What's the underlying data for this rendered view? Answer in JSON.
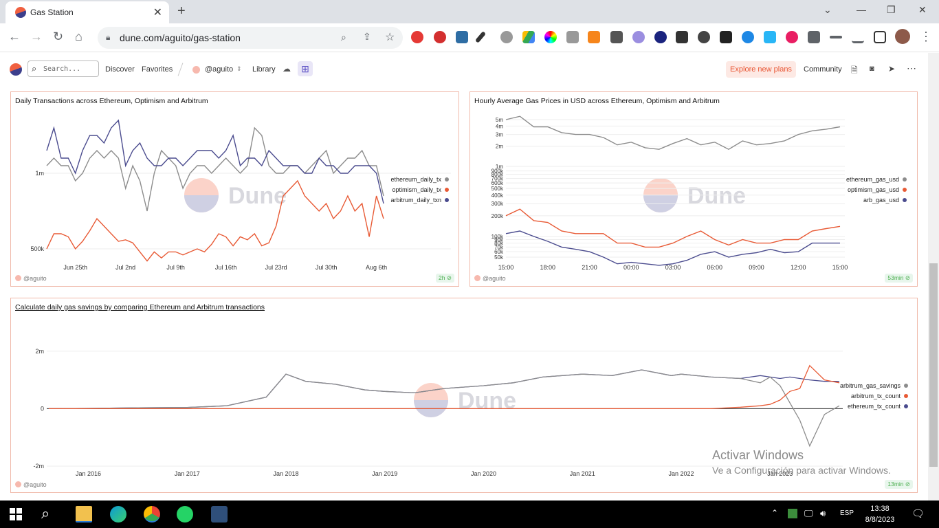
{
  "browser": {
    "tab_title": "Gas Station",
    "url": "dune.com/aguito/gas-station"
  },
  "header": {
    "search_placeholder": "Search...",
    "discover": "Discover",
    "favorites": "Favorites",
    "user": "@aguito",
    "library": "Library",
    "explore": "Explore new plans",
    "community": "Community"
  },
  "cards": [
    {
      "title": "Daily Transactions across Ethereum, Optimism and Arbitrum",
      "owner": "@aguito",
      "badge": "2h"
    },
    {
      "title": "Hourly Average Gas Prices in USD across Ethereum, Optimism and Arbitrum",
      "owner": "@aguito",
      "badge": "53min"
    },
    {
      "title": "Calculate daily gas savings by comparing Ethereum and Arbitrum transactions",
      "owner": "@aguito",
      "badge": "13min"
    }
  ],
  "watermark": "Dune",
  "colors": {
    "ethereum": "#8c8c8c",
    "optimism": "#e85a35",
    "arbitrum": "#4a4b8e"
  },
  "chart_data": [
    {
      "type": "line",
      "title": "Daily Transactions across Ethereum, Optimism and Arbitrum",
      "x": [
        "Jun 21",
        "Jun 22",
        "Jun 23",
        "Jun 24",
        "Jun 25",
        "Jun 26",
        "Jun 27",
        "Jun 28",
        "Jun 29",
        "Jun 30",
        "Jul 1",
        "Jul 2",
        "Jul 3",
        "Jul 4",
        "Jul 5",
        "Jul 6",
        "Jul 7",
        "Jul 8",
        "Jul 9",
        "Jul 10",
        "Jul 11",
        "Jul 12",
        "Jul 13",
        "Jul 14",
        "Jul 15",
        "Jul 16",
        "Jul 17",
        "Jul 18",
        "Jul 19",
        "Jul 20",
        "Jul 21",
        "Jul 22",
        "Jul 23",
        "Jul 24",
        "Jul 25",
        "Jul 26",
        "Jul 27",
        "Jul 28",
        "Jul 29",
        "Jul 30",
        "Jul 31",
        "Aug 1",
        "Aug 2",
        "Aug 3",
        "Aug 4",
        "Aug 5",
        "Aug 6",
        "Aug 7"
      ],
      "x_ticks": [
        "Jun 25th",
        "Jul 2nd",
        "Jul 9th",
        "Jul 16th",
        "Jul 23rd",
        "Jul 30th",
        "Aug 6th"
      ],
      "y_ticks": [
        "1m",
        "500k"
      ],
      "ylim": [
        400000,
        1400000
      ],
      "series": [
        {
          "name": "ethereum_daily_tx",
          "values": [
            1050000,
            1100000,
            1050000,
            1050000,
            950000,
            1000000,
            1100000,
            1150000,
            1100000,
            1150000,
            1100000,
            900000,
            1050000,
            950000,
            750000,
            1000000,
            1150000,
            1100000,
            1050000,
            900000,
            1000000,
            1050000,
            1050000,
            1000000,
            1050000,
            1100000,
            1050000,
            1000000,
            1050000,
            1300000,
            1250000,
            1050000,
            1000000,
            1000000,
            1050000,
            1050000,
            1000000,
            1050000,
            1100000,
            1150000,
            1000000,
            1050000,
            1100000,
            1100000,
            1150000,
            1050000,
            1050000,
            850000
          ]
        },
        {
          "name": "optimism_daily_tx",
          "values": [
            500000,
            600000,
            600000,
            580000,
            500000,
            550000,
            620000,
            700000,
            650000,
            600000,
            550000,
            560000,
            540000,
            480000,
            420000,
            480000,
            440000,
            480000,
            480000,
            460000,
            480000,
            500000,
            480000,
            530000,
            600000,
            580000,
            520000,
            580000,
            560000,
            600000,
            520000,
            540000,
            650000,
            850000,
            900000,
            950000,
            850000,
            800000,
            750000,
            800000,
            700000,
            750000,
            850000,
            750000,
            800000,
            580000,
            850000,
            700000
          ]
        },
        {
          "name": "arbitrum_daily_txn",
          "values": [
            1150000,
            1300000,
            1100000,
            1100000,
            1000000,
            1150000,
            1250000,
            1250000,
            1200000,
            1300000,
            1350000,
            1050000,
            1150000,
            1200000,
            1100000,
            1050000,
            1050000,
            1100000,
            1100000,
            1050000,
            1100000,
            1150000,
            1150000,
            1150000,
            1100000,
            1150000,
            1250000,
            1050000,
            1100000,
            1100000,
            1050000,
            1150000,
            1100000,
            1050000,
            1050000,
            1050000,
            1000000,
            1000000,
            1100000,
            1050000,
            1050000,
            1000000,
            1000000,
            1050000,
            1050000,
            1050000,
            1000000,
            800000
          ]
        }
      ]
    },
    {
      "type": "line",
      "title": "Hourly Average Gas Prices in USD across Ethereum, Optimism and Arbitrum",
      "x": [
        "15:00",
        "16:00",
        "17:00",
        "18:00",
        "19:00",
        "20:00",
        "21:00",
        "22:00",
        "23:00",
        "00:00",
        "01:00",
        "02:00",
        "03:00",
        "04:00",
        "05:00",
        "06:00",
        "07:00",
        "08:00",
        "09:00",
        "10:00",
        "11:00",
        "12:00",
        "13:00",
        "14:00",
        "15:00"
      ],
      "x_ticks": [
        "15:00",
        "18:00",
        "21:00",
        "00:00",
        "03:00",
        "06:00",
        "09:00",
        "12:00",
        "15:00"
      ],
      "y_ticks": [
        "5m",
        "4m",
        "3m",
        "2m",
        "1m",
        "900k",
        "800k",
        "700k",
        "600k",
        "500k",
        "400k",
        "300k",
        "200k",
        "100k",
        "90k",
        "80k",
        "70k",
        "60k",
        "50k"
      ],
      "scale": "log",
      "series": [
        {
          "name": "ethereum_gas_usd",
          "values": [
            5000000,
            5600000,
            3900000,
            3900000,
            3200000,
            3000000,
            3000000,
            2700000,
            2100000,
            2300000,
            1900000,
            1800000,
            2200000,
            2600000,
            2100000,
            2300000,
            1800000,
            2400000,
            2100000,
            2200000,
            2400000,
            3000000,
            3400000,
            3600000,
            3900000
          ]
        },
        {
          "name": "optimism_gas_usd",
          "values": [
            200000,
            250000,
            170000,
            160000,
            120000,
            110000,
            110000,
            110000,
            80000,
            80000,
            70000,
            70000,
            80000,
            100000,
            120000,
            90000,
            75000,
            90000,
            80000,
            80000,
            90000,
            90000,
            120000,
            130000,
            140000
          ]
        },
        {
          "name": "arb_gas_usd",
          "values": [
            110000,
            120000,
            100000,
            85000,
            70000,
            65000,
            60000,
            50000,
            40000,
            42000,
            40000,
            38000,
            40000,
            45000,
            55000,
            60000,
            50000,
            55000,
            58000,
            65000,
            58000,
            60000,
            80000,
            80000,
            80000
          ]
        }
      ]
    },
    {
      "type": "line",
      "title": "Calculate daily gas savings by comparing Ethereum and Arbitrum transactions",
      "x_ticks": [
        "Jan 2016",
        "Jan 2017",
        "Jan 2018",
        "Jan 2019",
        "Jan 2020",
        "Jan 2021",
        "Jan 2022",
        "Jan 2023"
      ],
      "y_ticks": [
        "2m",
        "0",
        "-2m"
      ],
      "ylim": [
        -2000000,
        3000000
      ],
      "x": [
        2015.6,
        2016,
        2016.5,
        2017,
        2017.4,
        2017.8,
        2018,
        2018.2,
        2018.5,
        2018.8,
        2019,
        2019.3,
        2019.6,
        2020,
        2020.3,
        2020.6,
        2021,
        2021.3,
        2021.6,
        2021.9,
        2022,
        2022.3,
        2022.6,
        2022.8,
        2022.9,
        2023,
        2023.1,
        2023.2,
        2023.3,
        2023.45,
        2023.6
      ],
      "series": [
        {
          "name": "arbitrum_gas_savings",
          "values": [
            0,
            10000,
            30000,
            40000,
            100000,
            400000,
            1200000,
            950000,
            850000,
            650000,
            600000,
            550000,
            700000,
            800000,
            900000,
            1100000,
            1200000,
            1150000,
            1350000,
            1150000,
            1200000,
            1100000,
            1050000,
            900000,
            1100000,
            800000,
            200000,
            -400000,
            -1300000,
            -200000,
            100000
          ]
        },
        {
          "name": "arbitrum_tx_count",
          "values": [
            0,
            0,
            0,
            0,
            0,
            0,
            0,
            0,
            0,
            0,
            0,
            0,
            0,
            0,
            0,
            0,
            0,
            0,
            0,
            0,
            0,
            0,
            50000,
            100000,
            150000,
            300000,
            600000,
            700000,
            1500000,
            1000000,
            900000
          ]
        },
        {
          "name": "ethereum_tx_count",
          "values": [
            0,
            10000,
            30000,
            40000,
            100000,
            400000,
            1200000,
            950000,
            850000,
            650000,
            600000,
            550000,
            700000,
            800000,
            900000,
            1100000,
            1200000,
            1150000,
            1350000,
            1150000,
            1200000,
            1100000,
            1050000,
            1150000,
            1100000,
            1050000,
            1100000,
            1050000,
            1000000,
            950000,
            950000
          ]
        }
      ]
    }
  ],
  "windows": {
    "activate_title": "Activar Windows",
    "activate_sub": "Ve a Configuración para activar Windows.",
    "lang": "ESP",
    "time": "13:38",
    "date": "8/8/2023"
  }
}
